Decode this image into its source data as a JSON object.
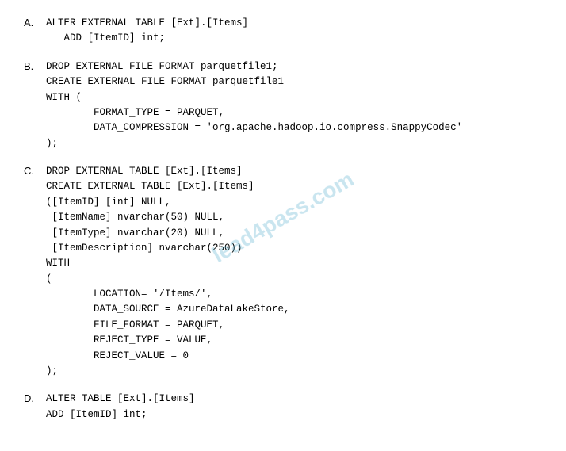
{
  "watermark": "lead4pass.com",
  "options": [
    {
      "letter": "A.",
      "lines": [
        "ALTER EXTERNAL TABLE [Ext].[Items]",
        "   ADD [ItemID] int;"
      ]
    },
    {
      "letter": "B.",
      "lines": [
        "DROP EXTERNAL FILE FORMAT parquetfile1;",
        "CREATE EXTERNAL FILE FORMAT parquetfile1",
        "WITH (",
        "        FORMAT_TYPE = PARQUET,",
        "        DATA_COMPRESSION = 'org.apache.hadoop.io.compress.SnappyCodec'",
        ");"
      ]
    },
    {
      "letter": "C.",
      "lines": [
        "DROP EXTERNAL TABLE [Ext].[Items]",
        "CREATE EXTERNAL TABLE [Ext].[Items]",
        "([ItemID] [int] NULL,",
        " [ItemName] nvarchar(50) NULL,",
        " [ItemType] nvarchar(20) NULL,",
        " [ItemDescription] nvarchar(250))",
        "WITH",
        "(",
        "        LOCATION= '/Items/',",
        "        DATA_SOURCE = AzureDataLakeStore,",
        "        FILE_FORMAT = PARQUET,",
        "        REJECT_TYPE = VALUE,",
        "        REJECT_VALUE = 0",
        ");"
      ]
    },
    {
      "letter": "D.",
      "lines": [
        "ALTER TABLE [Ext].[Items]",
        "ADD [ItemID] int;"
      ]
    }
  ]
}
